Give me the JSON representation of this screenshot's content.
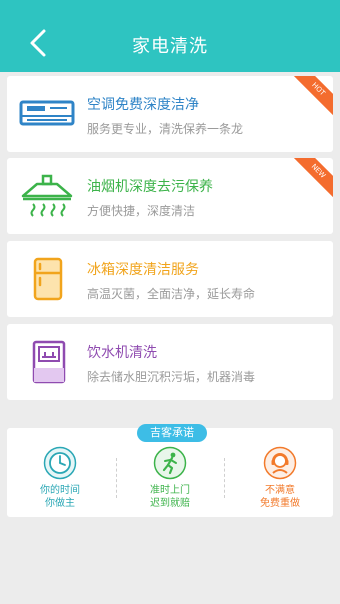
{
  "header": {
    "title": "家电清洗"
  },
  "services": [
    {
      "title": "空调免费深度洁净",
      "subtitle": "服务更专业，清洗保养一条龙",
      "badge": "HOT",
      "color": "#2f84c7",
      "icon": "air-conditioner-icon"
    },
    {
      "title": "油烟机深度去污保养",
      "subtitle": "方便快捷，深度清洁",
      "badge": "NEW",
      "color": "#3cb34a",
      "icon": "range-hood-icon"
    },
    {
      "title": "冰箱深度清洁服务",
      "subtitle": "高温灭菌，全面洁净，延长寿命",
      "color": "#f1a41c",
      "icon": "refrigerator-icon"
    },
    {
      "title": "饮水机清洗",
      "subtitle": "除去储水胆沉积污垢，机器消毒",
      "color": "#8f4bb0",
      "icon": "water-dispenser-icon"
    }
  ],
  "promise": {
    "tag": "吉客承诺",
    "items": [
      {
        "line1": "你的时间",
        "line2": "你做主",
        "color": "#2aa7b5",
        "icon": "clock-icon"
      },
      {
        "line1": "准时上门",
        "line2": "迟到就赔",
        "color": "#3cb34a",
        "icon": "running-man-icon"
      },
      {
        "line1": "不满意",
        "line2": "免费重做",
        "color": "#f27a2b",
        "icon": "customer-service-icon"
      }
    ]
  }
}
